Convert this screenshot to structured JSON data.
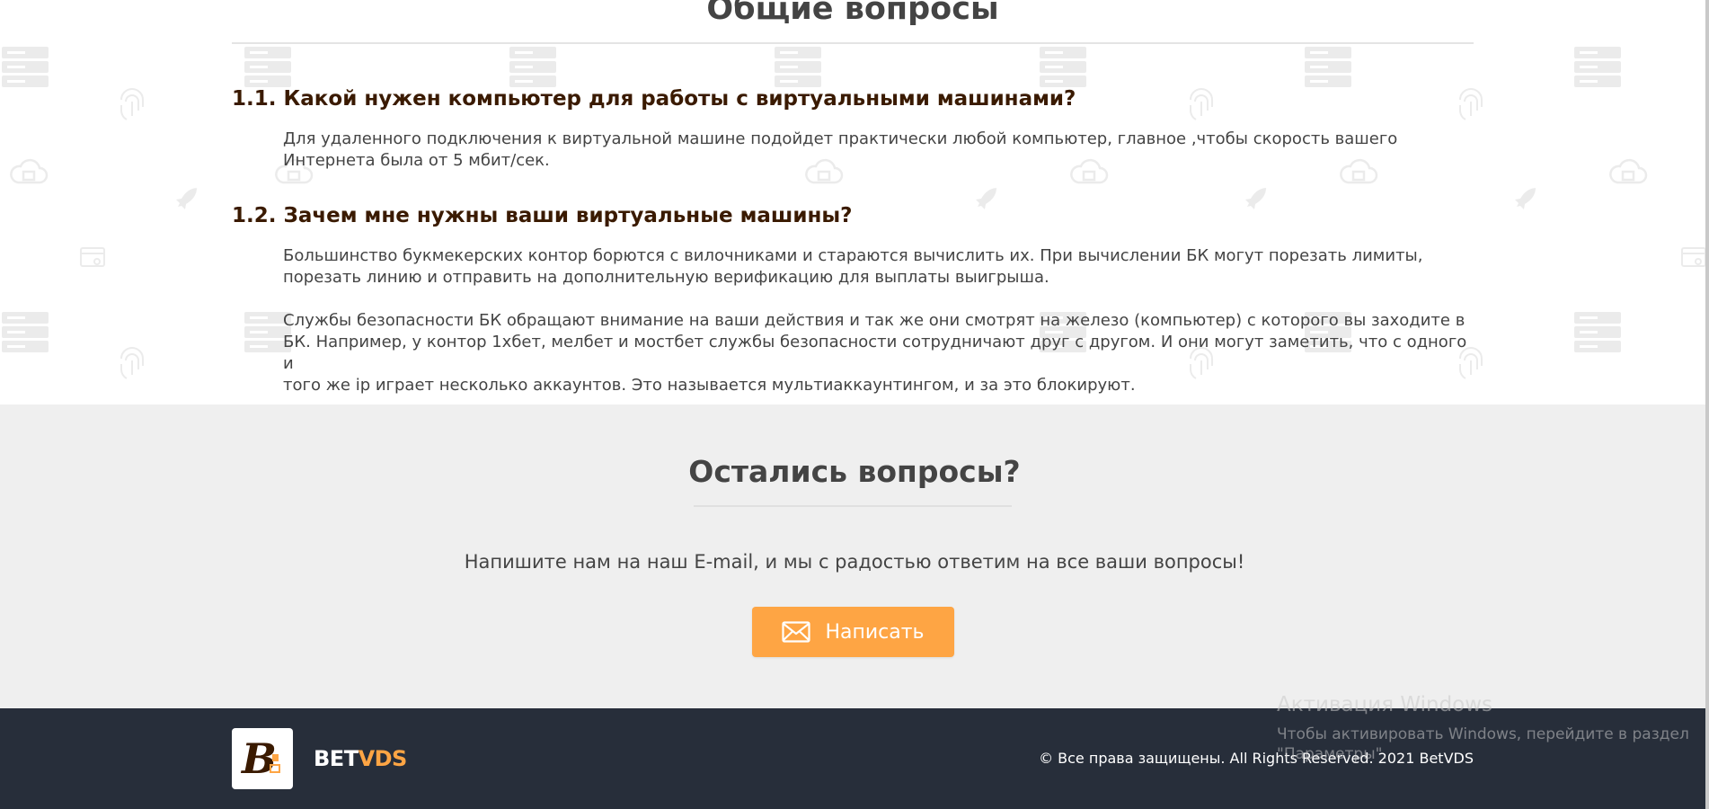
{
  "faq": {
    "title": "Общие вопросы",
    "items": [
      {
        "question": "1.1. Какой нужен компьютер для работы с виртуальными машинами?",
        "answer_lines": [
          "Для удаленного подключения к виртуальной машине подойдет практически любой компьютер, главное ,чтобы скорость вашего",
          "Интернета была от 5 мбит/сек."
        ]
      },
      {
        "question": "1.2. Зачем мне нужны ваши виртуальные машины?",
        "answer_paragraphs": [
          {
            "lines": [
              "Большинство букмекерских контор борются с вилочниками и стараются вычислить их. При вычислении БК могут порезать лимиты,",
              "порезать линию и отправить на дополнительную верификацию для выплаты выигрыша."
            ]
          },
          {
            "lines": [
              "Службы безопасности БК обращают внимание на ваши действия и так же они смотрят на железо (компьютер) с которого вы заходите в",
              "БК. Например, у контор 1хбет, мелбет и мостбет службы безопасности сотрудничают друг с другом. И они могут заметить, что с одного и",
              "того же ip играет несколько аккаунтов. Это называется мультиаккаунтингом, и за это блокируют."
            ]
          }
        ]
      }
    ]
  },
  "contact": {
    "title": "Остались вопросы?",
    "text": "Напишите нам на наш E-mail, и мы с радостью ответим на все ваши вопросы!",
    "button_label": "Написать",
    "button_icon": "envelope-icon",
    "accent_color": "#fea544"
  },
  "footer": {
    "brand_part1": "BET",
    "brand_part2": "VDS",
    "copyright": "© Все права защищены. All Rights Reserved. 2021 BetVDS",
    "background_color": "#272e3a"
  },
  "windows_activation": {
    "line1": "Активация Windows",
    "line2": "Чтобы активировать Windows, перейдите в раздел",
    "line3": "\"Параметры\"."
  }
}
